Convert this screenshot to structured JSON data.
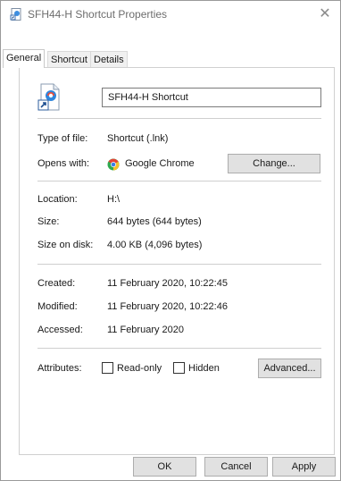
{
  "window": {
    "title": "SFH44-H Shortcut Properties",
    "close_glyph": "✕"
  },
  "tabs": [
    {
      "label": "General",
      "active": true
    },
    {
      "label": "Shortcut",
      "active": false
    },
    {
      "label": "Details",
      "active": false
    }
  ],
  "general": {
    "file_name": "SFH44-H Shortcut",
    "type_label": "Type of file:",
    "type_value": "Shortcut (.lnk)",
    "opens_label": "Opens with:",
    "opens_value": "Google Chrome",
    "change_button": "Change...",
    "location_label": "Location:",
    "location_value": "H:\\",
    "size_label": "Size:",
    "size_value": "644 bytes (644 bytes)",
    "size_disk_label": "Size on disk:",
    "size_disk_value": "4.00 KB (4,096 bytes)",
    "created_label": "Created:",
    "created_value": "11 February 2020, 10:22:45",
    "modified_label": "Modified:",
    "modified_value": "11 February 2020, 10:22:46",
    "accessed_label": "Accessed:",
    "accessed_value": "11 February 2020",
    "attributes_label": "Attributes:",
    "readonly_label": "Read-only",
    "hidden_label": "Hidden",
    "advanced_button": "Advanced..."
  },
  "footer": {
    "ok": "OK",
    "cancel": "Cancel",
    "apply": "Apply"
  },
  "icons": {
    "title": "shortcut-file-icon",
    "file": "shortcut-file-icon",
    "app": "chrome-icon"
  },
  "colors": {
    "title_text": "#6d6d6d",
    "button_face": "#e1e1e1"
  }
}
